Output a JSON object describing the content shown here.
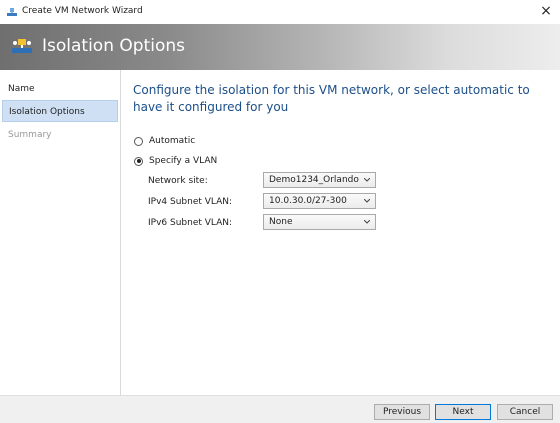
{
  "window": {
    "title": "Create VM Network Wizard",
    "close_glyph": "×"
  },
  "banner": {
    "title": "Isolation Options"
  },
  "sidebar": {
    "items": [
      {
        "label": "Name",
        "state": "normal"
      },
      {
        "label": "Isolation Options",
        "state": "selected"
      },
      {
        "label": "Summary",
        "state": "disabled"
      }
    ]
  },
  "main": {
    "heading": "Configure the isolation for this VM network, or select automatic to have it configured for you",
    "options": [
      {
        "label": "Automatic",
        "checked": false
      },
      {
        "label": "Specify a VLAN",
        "checked": true
      }
    ],
    "fields": [
      {
        "label": "Network site:",
        "value": "Demo1234_Orlando"
      },
      {
        "label": "IPv4 Subnet VLAN:",
        "value": "10.0.30.0/27-300"
      },
      {
        "label": "IPv6 Subnet VLAN:",
        "value": "None"
      }
    ]
  },
  "footer": {
    "previous_label": "Previous",
    "next_label": "Next",
    "cancel_label": "Cancel"
  },
  "colors": {
    "selected_bg": "#cfe0f4",
    "heading": "#1c4f8a",
    "default_button_border": "#0078d7"
  }
}
